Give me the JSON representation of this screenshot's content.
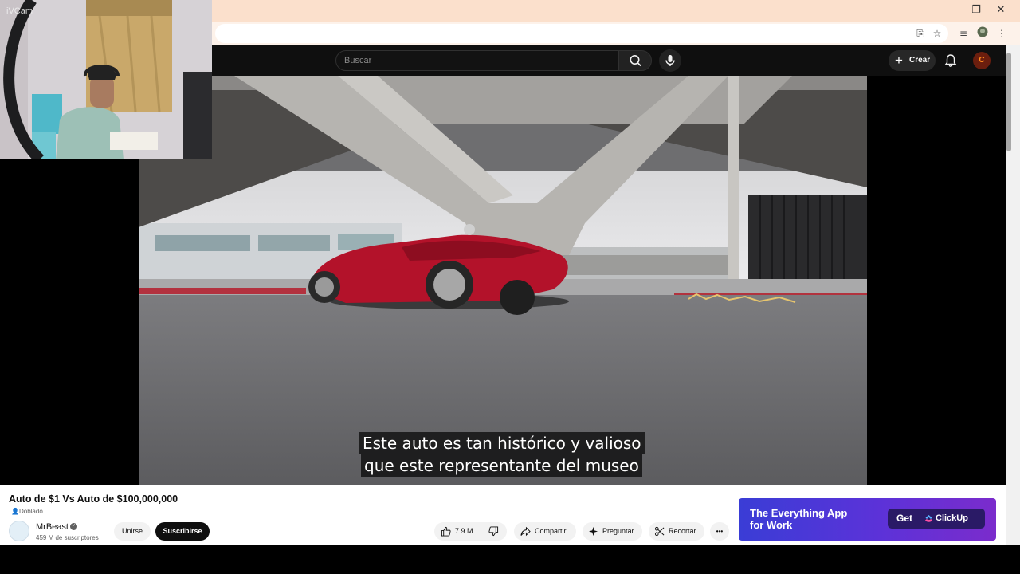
{
  "window": {
    "minimize": "–",
    "restore": "❐",
    "close": "✕"
  },
  "header": {
    "search_placeholder": "Buscar",
    "create_label": "Crear",
    "avatar_letter": "C"
  },
  "webcam": {
    "label": "iVCam"
  },
  "video": {
    "subtitles": [
      "Este auto es tan histórico y valioso",
      "que este representante del museo"
    ]
  },
  "info": {
    "title": "Auto de $1 Vs Auto de $100,000,000",
    "dubbed": "Doblado",
    "channel_name": "MrBeast",
    "subscribers": "459 M de suscriptores",
    "join_label": "Unirse",
    "subscribe_label": "Suscribirse",
    "likes": "7.9 M",
    "share_label": "Compartir",
    "ask_label": "Preguntar",
    "clip_label": "Recortar",
    "more_label": "•••"
  },
  "ad": {
    "headline_line1": "The Everything App",
    "headline_line2": "for Work",
    "cta_label": "Get",
    "brand": "ClickUp"
  },
  "colors": {
    "titlebar": "#fbe0cc",
    "yt_dark": "#0f0f0f",
    "car_red": "#b3122a",
    "ad_purple": "#5c32d8"
  }
}
